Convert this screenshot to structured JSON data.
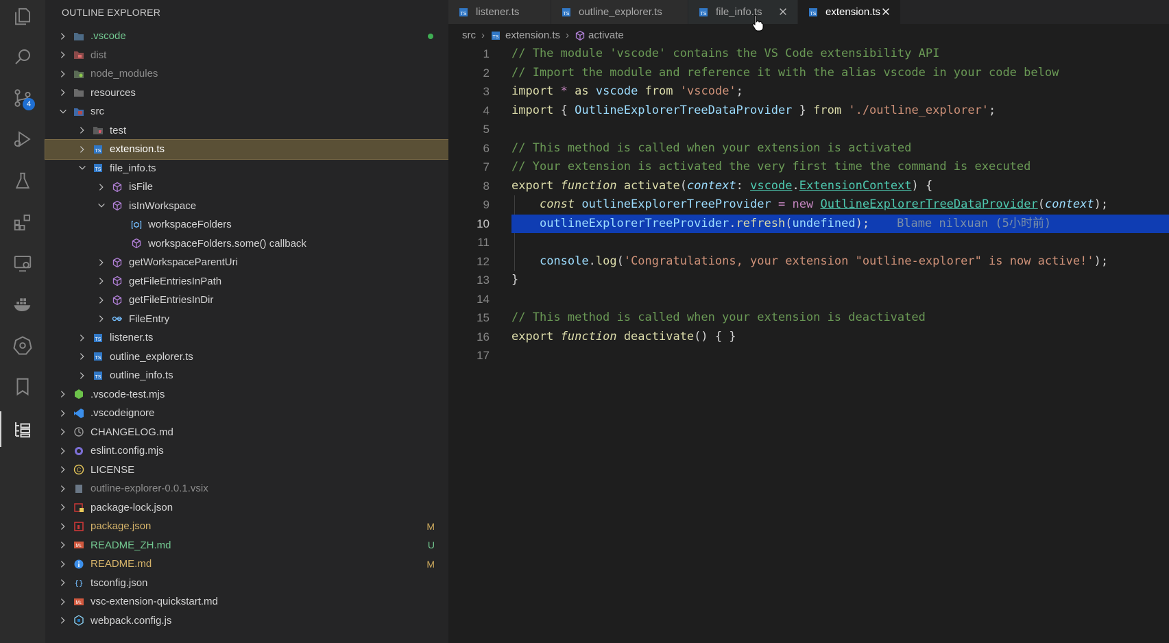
{
  "sidebar": {
    "title": "OUTLINE EXPLORER",
    "rows": [
      {
        "label": ".vscode",
        "status": "",
        "dot": true
      },
      {
        "label": "dist"
      },
      {
        "label": "node_modules"
      },
      {
        "label": "resources"
      },
      {
        "label": "src"
      },
      {
        "label": "test"
      },
      {
        "label": "extension.ts"
      },
      {
        "label": "file_info.ts"
      },
      {
        "label": "isFile"
      },
      {
        "label": "isInWorkspace"
      },
      {
        "label": "workspaceFolders"
      },
      {
        "label": "workspaceFolders.some() callback"
      },
      {
        "label": "getWorkspaceParentUri"
      },
      {
        "label": "getFileEntriesInPath"
      },
      {
        "label": "getFileEntriesInDir"
      },
      {
        "label": "FileEntry"
      },
      {
        "label": "listener.ts"
      },
      {
        "label": "outline_explorer.ts"
      },
      {
        "label": "outline_info.ts"
      },
      {
        "label": ".vscode-test.mjs"
      },
      {
        "label": ".vscodeignore"
      },
      {
        "label": "CHANGELOG.md"
      },
      {
        "label": "eslint.config.mjs"
      },
      {
        "label": "LICENSE"
      },
      {
        "label": "outline-explorer-0.0.1.vsix"
      },
      {
        "label": "package-lock.json"
      },
      {
        "label": "package.json",
        "status": "M"
      },
      {
        "label": "README_ZH.md",
        "status": "U"
      },
      {
        "label": "README.md",
        "status": "M"
      },
      {
        "label": "tsconfig.json"
      },
      {
        "label": "vsc-extension-quickstart.md"
      },
      {
        "label": "webpack.config.js"
      }
    ]
  },
  "activity": {
    "scm_badge": "4"
  },
  "tabs": [
    {
      "label": "listener.ts"
    },
    {
      "label": "outline_explorer.ts"
    },
    {
      "label": "file_info.ts"
    },
    {
      "label": "extension.ts"
    }
  ],
  "breadcrumb": {
    "folder": "src",
    "file": "extension.ts",
    "symbol": "activate"
  },
  "code": {
    "line_numbers": [
      "1",
      "2",
      "3",
      "4",
      "5",
      "6",
      "7",
      "8",
      "9",
      "10",
      "11",
      "12",
      "13",
      "14",
      "15",
      "16",
      "17"
    ],
    "blame": "Blame nilxuan (5小时前)"
  }
}
